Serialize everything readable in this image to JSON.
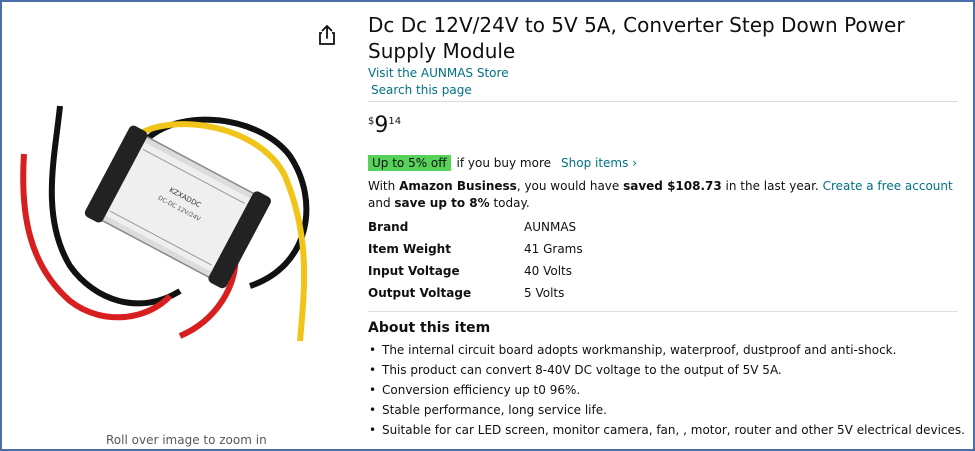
{
  "product": {
    "title": "Dc Dc 12V/24V to 5V 5A, Converter Step Down Power Supply Module",
    "store_link": "Visit the AUNMAS Store",
    "search_link": "Search this page",
    "image_hint": "Roll over image to zoom in",
    "share_icon": "share-icon"
  },
  "price": {
    "symbol": "$",
    "whole": "9",
    "fraction": "14"
  },
  "promo": {
    "badge": "Up to 5% off",
    "text": "if you buy more",
    "link": "Shop items ›"
  },
  "business": {
    "prefix": "With ",
    "brand": "Amazon Business",
    "middle": ", you would have ",
    "saved": "saved $108.73",
    "suffix": " in the last year. ",
    "link": "Create a free account",
    "and": " and ",
    "save_up": "save up to 8%",
    "end": " today."
  },
  "specs": [
    {
      "key": "Brand",
      "value": "AUNMAS"
    },
    {
      "key": "Item Weight",
      "value": "41 Grams"
    },
    {
      "key": "Input Voltage",
      "value": "40 Volts"
    },
    {
      "key": "Output Voltage",
      "value": "5 Volts"
    }
  ],
  "about": {
    "title": "About this item",
    "bullets": [
      "The internal circuit board adopts workmanship, waterproof, dustproof and anti-shock.",
      "This product can convert 8-40V DC voltage to the output of 5V 5A.",
      "Conversion efficiency up t0 96%.",
      "Stable performance, long service life.",
      "Suitable for car LED screen, monitor camera, fan, , motor, router and other 5V electrical devices."
    ]
  },
  "colors": {
    "link": "#007185",
    "badge": "#56d25a",
    "frame": "#4a6fa8"
  }
}
